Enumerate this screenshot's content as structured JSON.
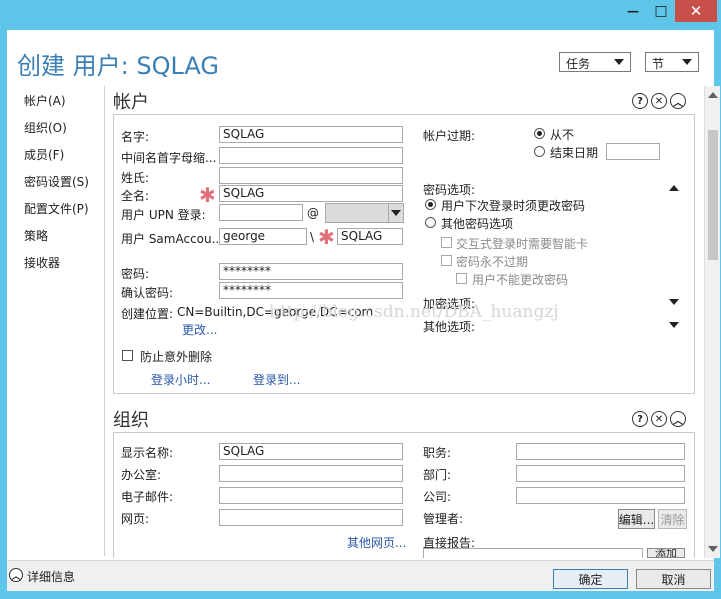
{
  "window": {
    "minimize_glyph": "—",
    "maximize_glyph": "□",
    "close_glyph": "✕"
  },
  "header": {
    "title": "创建 用户: SQLAG",
    "tasks_label": "任务",
    "sections_label": "节"
  },
  "nav": {
    "items": [
      "帐户(A)",
      "组织(O)",
      "成员(F)",
      "密码设置(S)",
      "配置文件(P)",
      "策略",
      "接收器"
    ]
  },
  "account": {
    "heading": "帐户",
    "first_name_label": "名字:",
    "first_name_value": "SQLAG",
    "initials_label": "中间名首字母缩...",
    "initials_value": "",
    "last_name_label": "姓氏:",
    "last_name_value": "",
    "full_name_label": "全名:",
    "full_name_value": "SQLAG",
    "upn_label": "用户 UPN 登录:",
    "upn_value": "",
    "at_sign": "@",
    "sam_label": "用户 SamAccou...",
    "sam_domain_value": "george",
    "backslash": "\\",
    "sam_name_value": "SQLAG",
    "password_label": "密码:",
    "password_value": "********",
    "confirm_label": "确认密码:",
    "confirm_value": "********",
    "location_label": "创建位置:",
    "location_value": "CN=Builtin,DC=george,DC=com",
    "change_link": "更改...",
    "protect_label": "防止意外删除",
    "logon_hours_link": "登录小时...",
    "logon_to_link": "登录到...",
    "expiry_label": "帐户过期:",
    "never_label": "从不",
    "end_date_label": "结束日期",
    "end_date_value": "",
    "pwd_options_label": "密码选项:",
    "must_change_label": "用户下次登录时须更改密码",
    "other_options_label": "其他密码选项",
    "smartcard_label": "交互式登录时需要智能卡",
    "never_expire_label": "密码永不过期",
    "cannot_change_label": "用户不能更改密码",
    "encryption_label": "加密选项:",
    "other_label": "其他选项:"
  },
  "org": {
    "heading": "组织",
    "display_name_label": "显示名称:",
    "display_name_value": "SQLAG",
    "office_label": "办公室:",
    "office_value": "",
    "email_label": "电子邮件:",
    "email_value": "",
    "webpage_label": "网页:",
    "webpage_value": "",
    "more_pages_link": "其他网页...",
    "job_title_label": "职务:",
    "job_title_value": "",
    "department_label": "部门:",
    "department_value": "",
    "company_label": "公司:",
    "company_value": "",
    "manager_label": "管理者:",
    "edit_button": "编辑...",
    "clear_button": "清除",
    "direct_reports_label": "直接报告:",
    "add_button": "添加"
  },
  "footer": {
    "details_label": "详细信息",
    "ok_button": "确定",
    "cancel_button": "取消"
  },
  "watermark": "http://blog.csdn.net/DBA_huangzj",
  "colors": {
    "titlebar": "#5ec6e8",
    "title_text": "#3a7fb6",
    "link": "#2a58a8",
    "required_star": "#e0707a",
    "close_button": "#c7504a"
  }
}
